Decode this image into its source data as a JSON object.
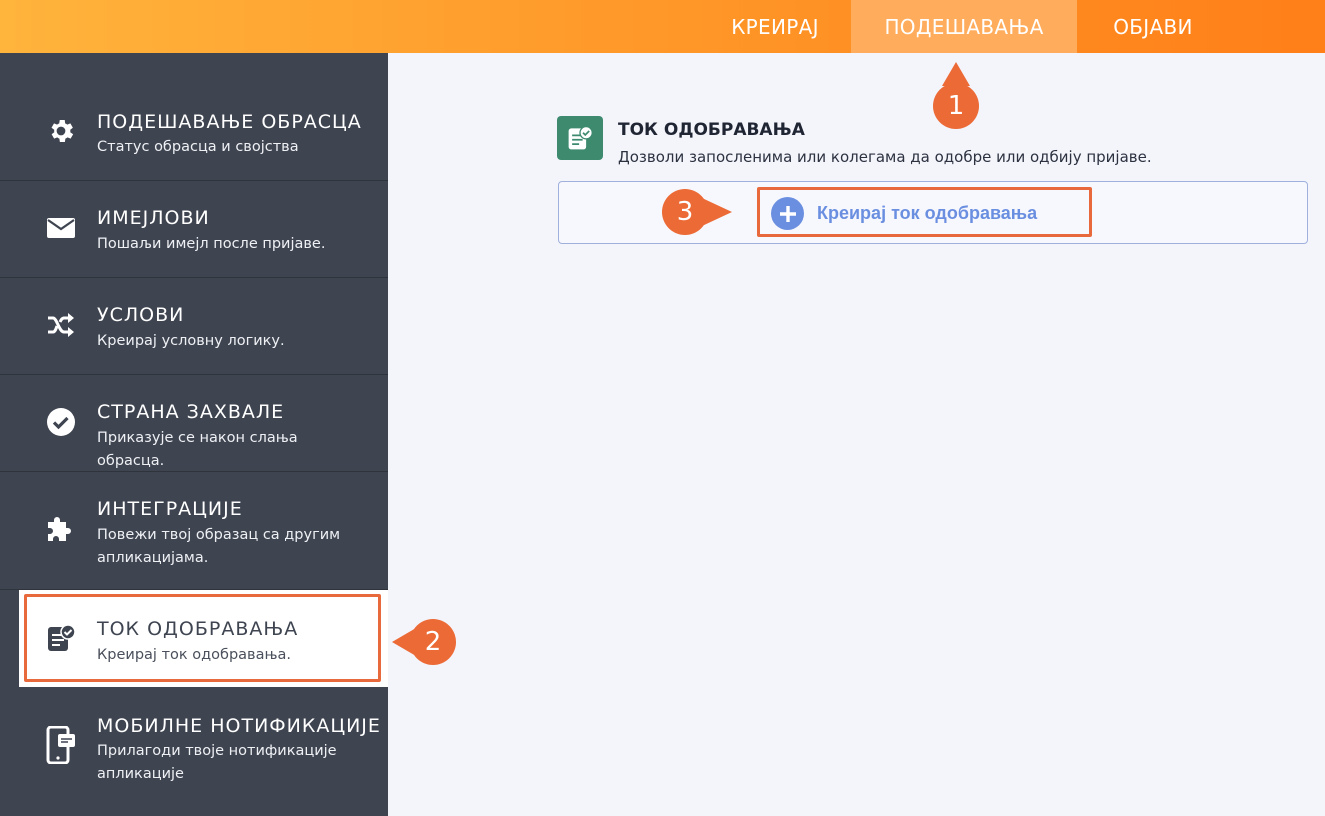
{
  "nav": {
    "tabs": [
      {
        "label": "КРЕИРАЈ"
      },
      {
        "label": "ПОДЕШАВАЊА"
      },
      {
        "label": "ОБЈАВИ"
      }
    ]
  },
  "sidebar": {
    "items": [
      {
        "title": "ПОДЕШАВАЊЕ ОБРАСЦА",
        "desc": "Статус обрасца и својства",
        "icon": "gear-icon"
      },
      {
        "title": "ИМЕЈЛОВИ",
        "desc": "Пошаљи имејл после пријаве.",
        "icon": "envelope-icon"
      },
      {
        "title": "УСЛОВИ",
        "desc": "Креирај условну логику.",
        "icon": "shuffle-icon"
      },
      {
        "title": "СТРАНА ЗАХВАЛЕ",
        "desc": "Приказује се након слања обрасца.",
        "icon": "check-circle-icon"
      },
      {
        "title": "ИНТЕГРАЦИЈЕ",
        "desc": "Повежи твој образац са другим апликацијама.",
        "icon": "puzzle-icon"
      },
      {
        "title": "ТОК ОДОБРАВАЊА",
        "desc": "Креирај ток одобравања.",
        "icon": "approval-doc-icon"
      },
      {
        "title": "МОБИЛНЕ НОТИФИКАЦИЈЕ",
        "desc": "Прилагоди твоје нотификације апликације",
        "icon": "mobile-notification-icon"
      }
    ]
  },
  "main": {
    "section_title": "ТОК ОДОБРАВАЊА",
    "section_desc": "Дозволи запосленима или колегама да одобре или одбију пријаве.",
    "create_label": "Креирај ток одобравања"
  },
  "markers": [
    "1",
    "2",
    "3"
  ],
  "colors": {
    "accent_orange": "#ff9a2a",
    "marker": "#ec6a35",
    "sidebar_bg": "#3e4450",
    "link_blue": "#6b8fe0",
    "approval_green": "#3d8a6f"
  }
}
